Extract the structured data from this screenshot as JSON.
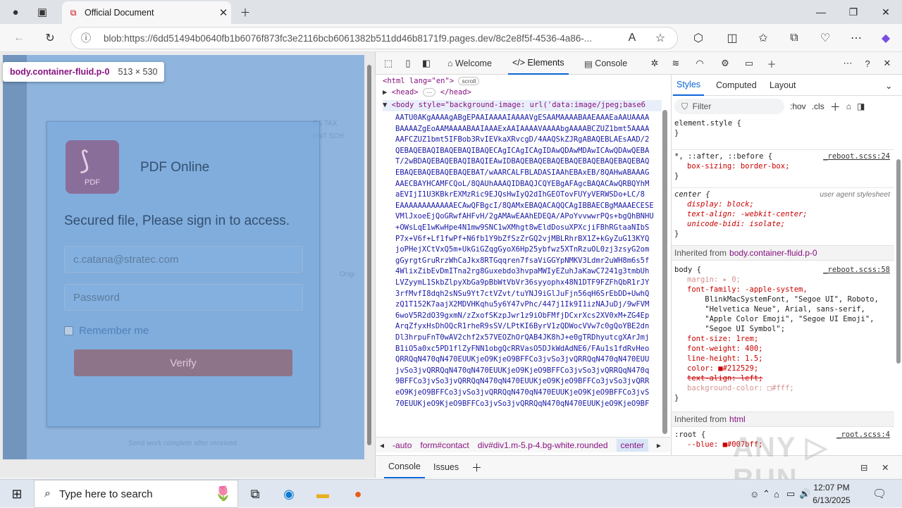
{
  "browser": {
    "tab_title": "Official Document",
    "url": "blob:https://6dd51494b0640fb1b6076f873fc3e2116bcb6061382b511dd46b8171f9.pages.dev/8c2e8f5f-4536-4a86-..."
  },
  "page": {
    "tooltip_selector": "body.container-fluid.p-0",
    "tooltip_size": "513 × 530",
    "app_title": "PDF Online",
    "logo_label": "PDF",
    "heading": "Secured file, Please sign in to access.",
    "email_value": "c.catana@stratec.com",
    "password_placeholder": "Password",
    "remember_label": "Remember me",
    "verify_label": "Verify"
  },
  "devtools": {
    "tabs": [
      "Welcome",
      "Elements",
      "Console"
    ],
    "html_line": {
      "open": "<html lang=\"en\">",
      "badge": "scroll"
    },
    "head_line": "<head>",
    "head_close": "</head>",
    "body_open": "<body style=\"background-image: url('data:image/jpeg;base6",
    "base64_lines": [
      "AATU0AKgAAAAgABgEPAAIAAAAIAAAAVgESAAMAAAABAAEAAAEaAAUAAAA",
      "BAAAAZgEoAAMAAAABAAIAAAExAAIAAAAVAAAAbgAAAABCZUZ1bmt5AAAA",
      "AAFCZUZ1bmt5IFBob3RvIEVkaXRvcgD/4AAQSkZJRgABAQEBLAEsAAD/2",
      "QEBAQEBAQIBAQEBAQIBAQECAgICAgICAgIDAwQDAwMDAwICAwQDAwQEBA",
      "T/2wBDAQEBAQEBAQIBAQIEAwIDBAQEBAQEBAQEBAQEBAQEBAQEBAQEBAQ",
      "EBAQEBAQEBAQEBAQEBAT/wAARCALFBLADASIAAhEBAxEB/8QAHwABAAAG",
      "AAECBAYHCAMFCQoL/8QAUhAAAQIDBAQJCQYEBgAFAgcBAQACAwQRBQYhM",
      "aEVIjI1U3KBkrEXMzRic9EJQsHwIyQ2dIhGEOTovFUYyVERWSDo+LC/8",
      "EAAAAAAAAAAAAECAwQFBgcI/8QAMxEBAQACAQQCAgIBBAECBgMAAAECESE",
      "VMlJxoeEjQoGRwfAHFvH/2gAMAwEAAhEDEQA/APoYvvwwrPQs+bgQhBNHU",
      "+OWsLqE1wKwHpe4N1mw9SNC1wXMhgt8wEldDosuXPXcjiFBhRGtaaNIbS",
      "P7x+V6f+Lf1fwPf+N6fb1Y9bZfSzZrGQ2vjMBLRhrBX1Z+kGyZuG13KYQ",
      "joPHejXCtVxQ5m+UkGiGZqgGyoX6Hp25ybfwz5XTnRzuOL0zj3zsyG2om",
      "gGyrgtGruRrzWhCaJkx8RTGqqren7fsaViGGYpNMKV3Ldmr2uWH8m6s5f",
      "4WlixZibEvDmITna2rg8Guxebdo3hvpaMWIyEZuhJaKawC7241g3tmbUh",
      "LVZyymL1SkbZlpyXbGa9pBbWtVbVr36syyophx48N1DTF9FZFhQbR1rJY",
      "3rfMvfI8dqh2sNSu9Yt7ctVZvt/tuYNJ9iGlJuFjn56qH6SrEbDD+UwhQ",
      "zQ1T152K7aajX2MDVHKqhu5y6Y47vPhc/447j1Ik9I1izNAJuDj/9wFVM",
      "6woV5R2dO39gxmN/zZxofSKzpJwr1z9iObFMfjDCxrXcs2XV0xM+ZG4Ep",
      "ArqZfyxHsDhOQcR1rheR9sSV/LPtKI6ByrV1zQDWocVVw7c0gQoYBE2dn",
      "Dl3hrpuFnT0wAV2chf2x57VEOZhOrQAB4JK8hJ+e0gTRDhyutcgXArJmj",
      "B1iO5a0xc5PD1flZyFNN1obgQcRRVasO5DJkWdAdNE6/FAu1s1fdRvHeo",
      "QRRQqN470qN470EUUKjeO9KjeO9BFFCo3jvSo3jvQRRQqN470qN470EUU",
      "jvSo3jvQRRQqN470qN470EUUKjeO9KjeO9BFFCo3jvSo3jvQRRQqN470q",
      "9BFFCo3jvSo3jvQRRQqN470qN470EUUKjeO9KjeO9BFFCo3jvSo3jvQRR",
      "eO9KjeO9BFFCo3jvSo3jvQRRQqN470qN470EUUKjeO9KjeO9BFFCo3jvS",
      "70EUUKjeO9KjeO9BFFCo3jvSo3jvQRRQqN470qN470EUUKjeO9KjeO9BF"
    ],
    "breadcrumb": [
      "-auto",
      "form#contact",
      "div#div1.m-5.p-4.bg-white.rounded",
      "center"
    ],
    "drawer_tabs": [
      "Console",
      "Issues"
    ],
    "styles_tabs": [
      "Styles",
      "Computed",
      "Layout"
    ],
    "filter_placeholder": "Filter",
    "filter_options": [
      ":hov",
      ".cls"
    ],
    "rules": {
      "element_style": "element.style {",
      "universal_selector": "*, ::after, ::before {",
      "universal_source": "_reboot.scss:24",
      "box_sizing": "box-sizing: border-box;",
      "center_selector": "center {",
      "ua_label": "user agent stylesheet",
      "center_props": [
        "display: block;",
        "text-align: -webkit-center;",
        "unicode-bidi: isolate;"
      ],
      "inherited1_label": "Inherited from",
      "inherited1_ref": "body.container-fluid.p-0",
      "body_selector": "body {",
      "body_source": "_reboot.scss:58",
      "body_props": [
        "margin: ▸ 0;",
        "font-family: -apple-system,",
        "    BlinkMacSystemFont, \"Segoe UI\", Roboto,",
        "    \"Helvetica Neue\", Arial, sans-serif,",
        "    \"Apple Color Emoji\", \"Segoe UI Emoji\",",
        "    \"Segoe UI Symbol\";",
        "font-size: 1rem;",
        "font-weight: 400;",
        "line-height: 1.5;",
        "color: ■#212529;",
        "text-align: left;",
        "background-color: □#fff;"
      ],
      "inherited2_label": "Inherited from",
      "inherited2_ref": "html",
      "root_selector": ":root {",
      "root_source": "_root.scss:4",
      "root_prop": "--blue: ■#007bff;"
    }
  },
  "taskbar": {
    "search_placeholder": "Type here to search",
    "time": "12:07 PM",
    "date": "6/13/2025"
  },
  "colors": {
    "accent": "#0a64d8",
    "tag": "#881280",
    "overlay": "#70a0d6"
  }
}
